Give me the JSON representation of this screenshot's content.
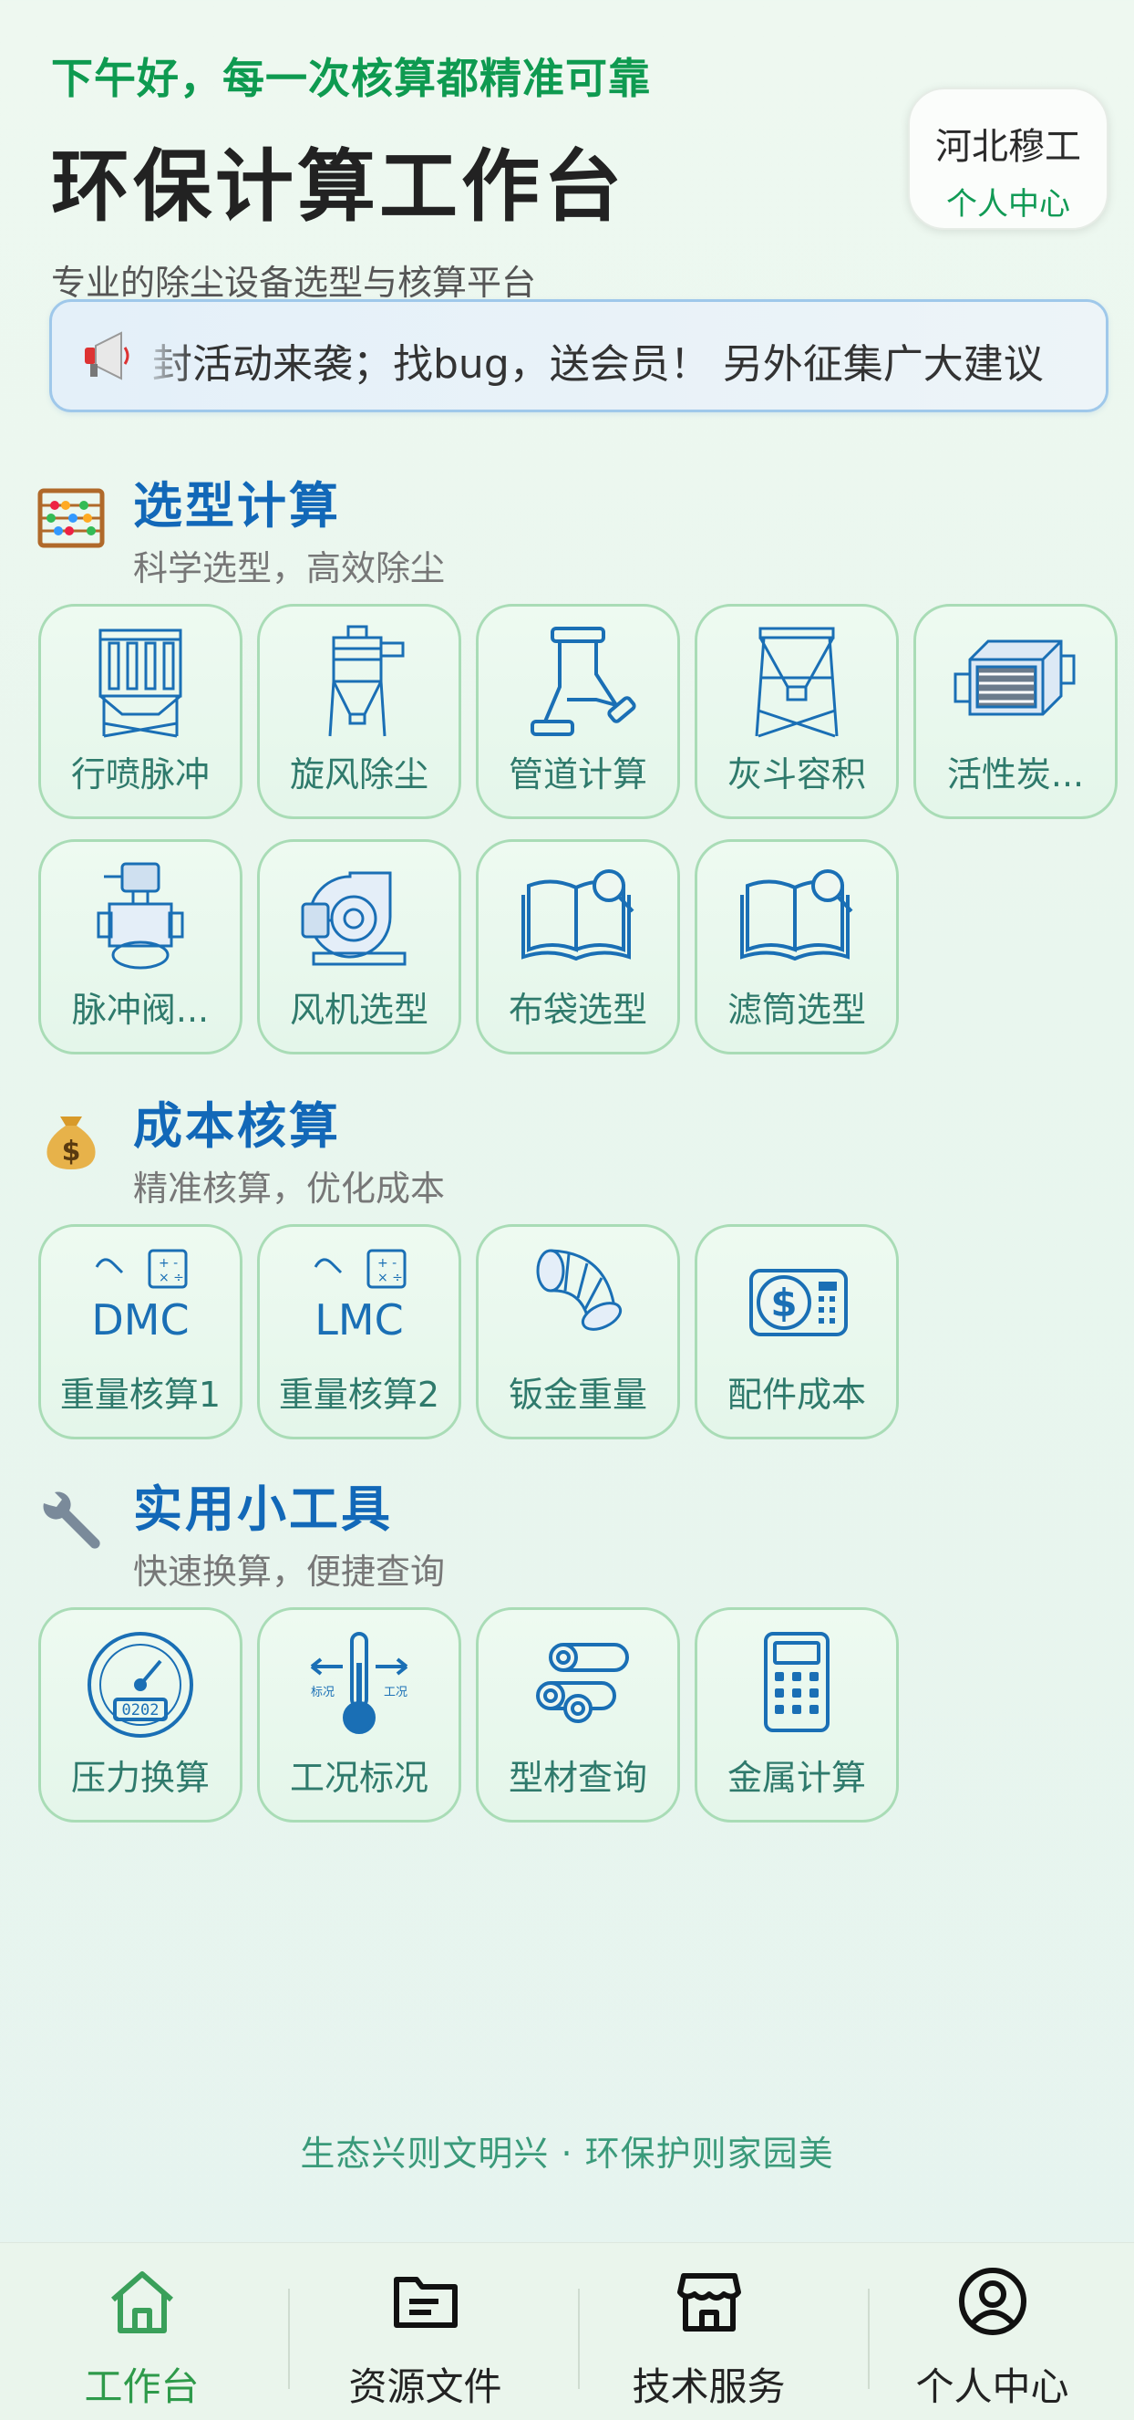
{
  "header": {
    "greeting": "下午好，每一次核算都精准可靠",
    "title": "环保计算工作台",
    "subtitle": "专业的除尘设备选型与核算平台"
  },
  "profile": {
    "name": "河北穆工",
    "link": "个人中心"
  },
  "notice": {
    "text": "封活动来袭；找bug，送会员！ 另外征集广大建议"
  },
  "sections": {
    "selection": {
      "title": "选型计算",
      "subtitle": "科学选型，高效除尘",
      "items": [
        {
          "label": "行喷脉冲",
          "icon": "baghouse-icon"
        },
        {
          "label": "旋风除尘",
          "icon": "cyclone-icon"
        },
        {
          "label": "管道计算",
          "icon": "pipe-icon"
        },
        {
          "label": "灰斗容积",
          "icon": "hopper-icon"
        },
        {
          "label": "活性炭...",
          "icon": "carbon-box-icon"
        },
        {
          "label": "脉冲阀...",
          "icon": "pulse-valve-icon"
        },
        {
          "label": "风机选型",
          "icon": "fan-icon"
        },
        {
          "label": "布袋选型",
          "icon": "book-search-icon"
        },
        {
          "label": "滤筒选型",
          "icon": "book-search-icon"
        }
      ]
    },
    "cost": {
      "title": "成本核算",
      "subtitle": "精准核算，优化成本",
      "items": [
        {
          "label": "重量核算1",
          "icon": "dmc-calc-icon",
          "tag": "DMC"
        },
        {
          "label": "重量核算2",
          "icon": "lmc-calc-icon",
          "tag": "LMC"
        },
        {
          "label": "钣金重量",
          "icon": "elbow-duct-icon"
        },
        {
          "label": "配件成本",
          "icon": "dollar-calc-icon"
        }
      ]
    },
    "tools": {
      "title": "实用小工具",
      "subtitle": "快速换算，便捷查询",
      "items": [
        {
          "label": "压力换算",
          "icon": "pressure-gauge-icon",
          "display": "0202"
        },
        {
          "label": "工况标况",
          "icon": "thermometer-icon",
          "left_tag": "标况",
          "right_tag": "工况"
        },
        {
          "label": "型材查询",
          "icon": "pipes-bundle-icon"
        },
        {
          "label": "金属计算",
          "icon": "calculator-icon"
        }
      ]
    }
  },
  "footer": {
    "slogan": "生态兴则文明兴 · 环保护则家园美"
  },
  "tabs": [
    {
      "label": "工作台",
      "icon": "home-icon",
      "active": true
    },
    {
      "label": "资源文件",
      "icon": "folder-icon",
      "active": false
    },
    {
      "label": "技术服务",
      "icon": "store-icon",
      "active": false
    },
    {
      "label": "个人中心",
      "icon": "user-icon",
      "active": false
    }
  ],
  "colors": {
    "accent_green": "#0e9a50",
    "section_blue": "#1268b8",
    "tile_border": "#a9dcb6",
    "icon_blue": "#1a6fb5"
  }
}
